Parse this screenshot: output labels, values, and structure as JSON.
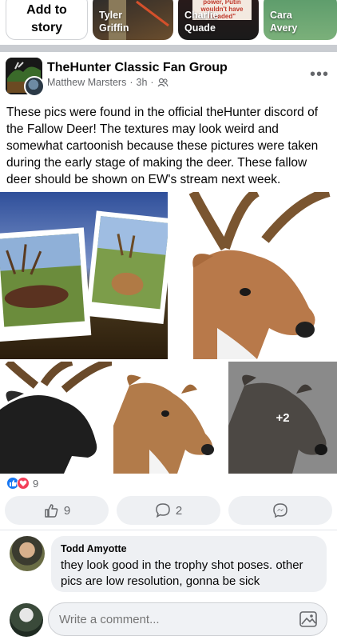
{
  "stories": {
    "add_line1": "Add to",
    "add_line2": "story",
    "items": [
      {
        "name_line1": "Tyler",
        "name_line2": "Griffin"
      },
      {
        "name_line1": "Charlie",
        "name_line2": "Quade",
        "overlay": "power, Putin wouldn't have invaded\""
      },
      {
        "name_line1": "Cara",
        "name_line2": "Avery"
      }
    ]
  },
  "post": {
    "group_name": "TheHunter Classic Fan Group",
    "author": "Matthew Marsters",
    "time": "3h",
    "body": "These pics were found in the official theHunter discord of the Fallow Deer! The textures may look weird and somewhat cartoonish because these pictures were taken during the early stage of making the deer. These fallow deer should be shown on EW's stream next week.",
    "more_photos": "+2",
    "reaction_count": "9",
    "like_count": "9",
    "comment_count": "2"
  },
  "comment": {
    "author": "Todd Amyotte",
    "text": "they look good in the trophy shot poses. other pics are low resolution, gonna be sick"
  },
  "composer": {
    "placeholder": "Write a comment..."
  },
  "colors": {
    "like_blue": "#1877f2",
    "love_red": "#f33e58",
    "meta_gray": "#65676b",
    "separator": "#c9ccd1"
  }
}
